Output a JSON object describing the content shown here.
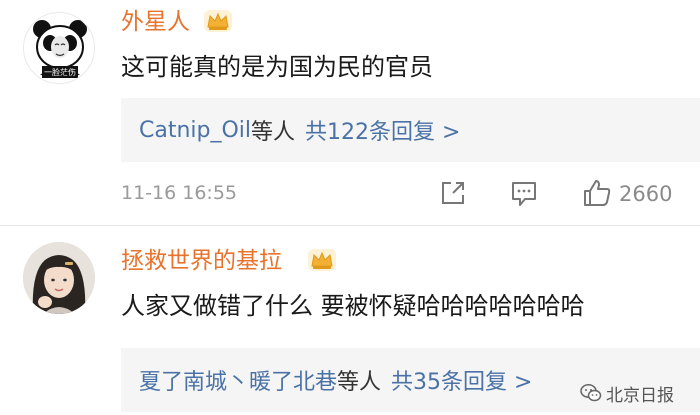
{
  "comments": [
    {
      "username": "外星人",
      "text": "这可能真的是为国为民的官员",
      "reply_names": "Catnip_Oil",
      "reply_suffix": "等人",
      "reply_count": "共122条回复 >",
      "timestamp": "11-16 16:55",
      "likes": "2660",
      "avatar_caption": "一脸茫伤"
    },
    {
      "username": "拯救世界的基拉",
      "text": "人家又做错了什么 要被怀疑哈哈哈哈哈哈哈",
      "reply_names": "夏了南城丶暖了北巷",
      "reply_suffix": "等人",
      "reply_count": "共35条回复 >"
    }
  ],
  "watermark": "北京日报",
  "colors": {
    "username": "#e8732c",
    "link": "#4a72a6",
    "crown": "#f2b134",
    "reply_bg": "#f5f5f5"
  },
  "icons": [
    "crown-icon",
    "share-icon",
    "comment-icon",
    "thumbs-up-icon",
    "wechat-icon"
  ]
}
